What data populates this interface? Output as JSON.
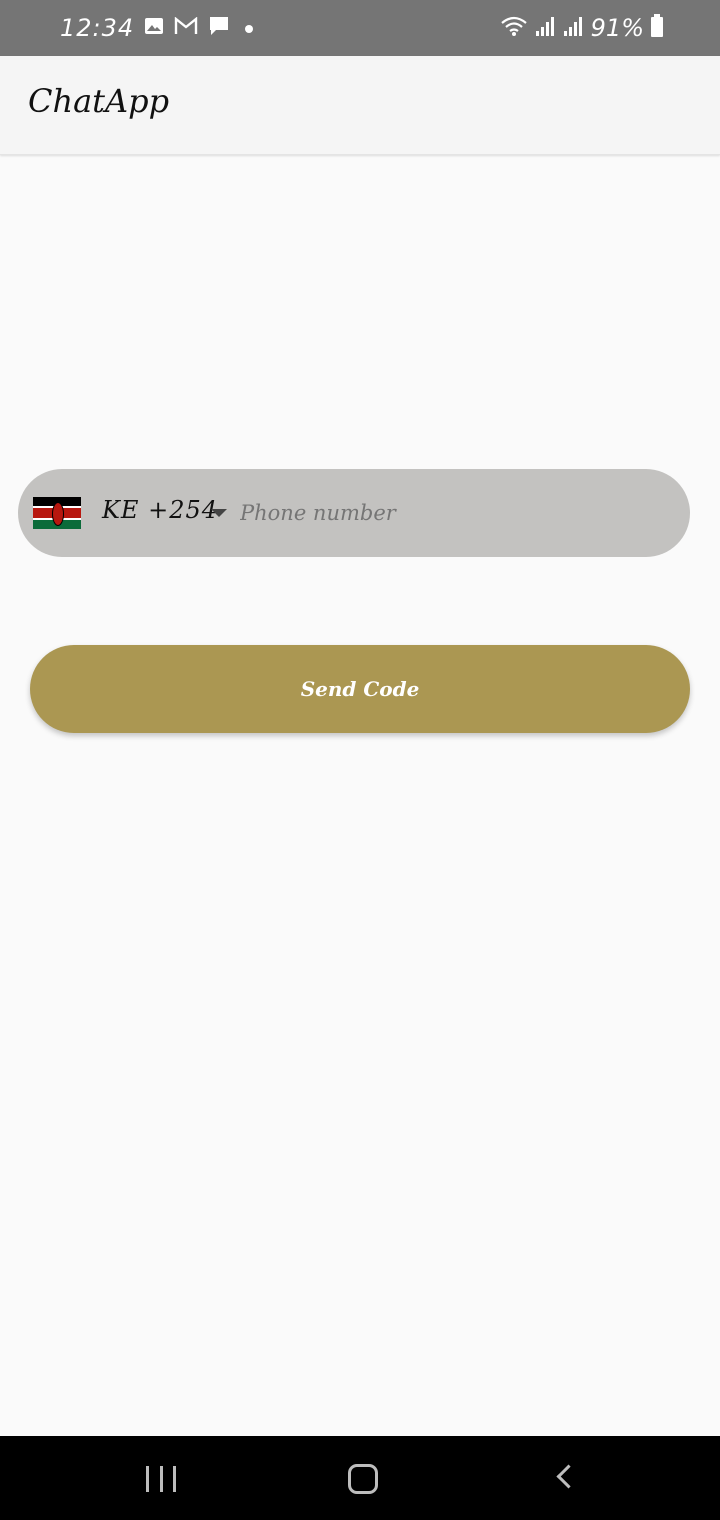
{
  "status_bar": {
    "time": "12:34",
    "battery_percent": "91%",
    "left_icons": [
      "image-icon",
      "gmail-icon",
      "message-icon",
      "dot-icon"
    ],
    "right_icons": [
      "wifi-icon",
      "signal-icon",
      "signal-icon",
      "battery-icon"
    ],
    "background_color": "#757575"
  },
  "app_bar": {
    "title": "ChatApp"
  },
  "phone_form": {
    "country_flag": "kenya-flag-icon",
    "country_code": "KE  +254",
    "phone_placeholder": "Phone number",
    "phone_value": "",
    "field_color": "#c3c2c0"
  },
  "send_button": {
    "label": "Send Code",
    "color": "#ab9752"
  },
  "nav_bar": {
    "buttons": [
      "recents-icon",
      "home-icon",
      "back-icon"
    ]
  }
}
